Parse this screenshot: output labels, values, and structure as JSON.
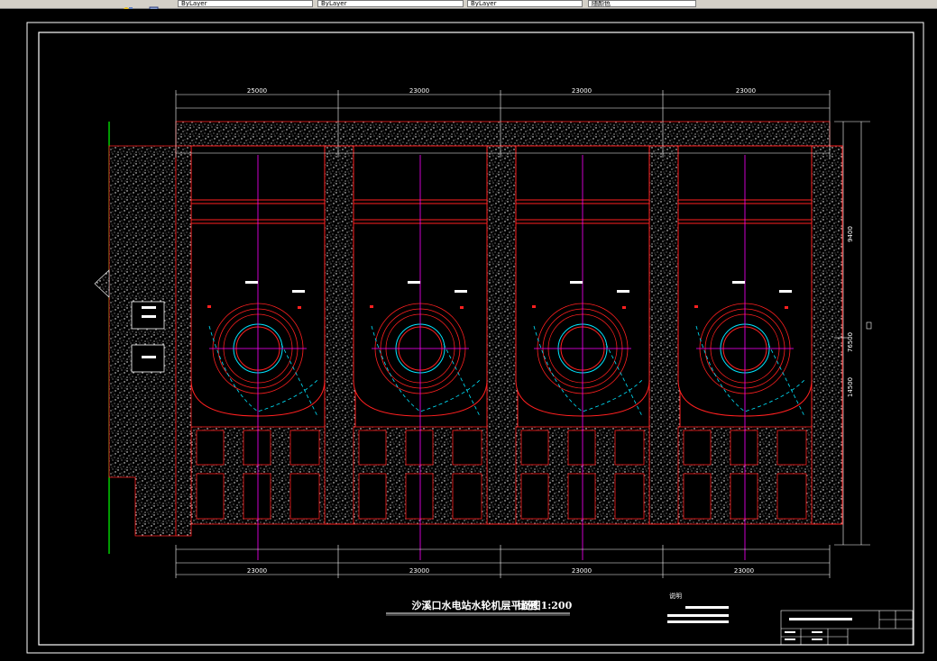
{
  "toolbar": {
    "fields": [
      "ByLayer",
      "ByLayer",
      "ByLayer",
      "随颜色"
    ]
  },
  "drawing": {
    "title": "沙溪口水电站水轮机层平面图",
    "scale_label": "比例 1:200",
    "notes_heading": "说明",
    "top_dims": [
      "25000",
      "23000",
      "23000",
      "23000"
    ],
    "bottom_dims": [
      "23000",
      "23000",
      "23000",
      "23000"
    ],
    "right_dims": [
      "9400",
      "76500",
      "14500"
    ],
    "colors": {
      "frame": "#ffffff",
      "outline": "#ff2020",
      "axis": "#ff00ff",
      "cyan": "#00e5ff",
      "green": "#00ff00",
      "concrete": "#ffffff"
    }
  }
}
